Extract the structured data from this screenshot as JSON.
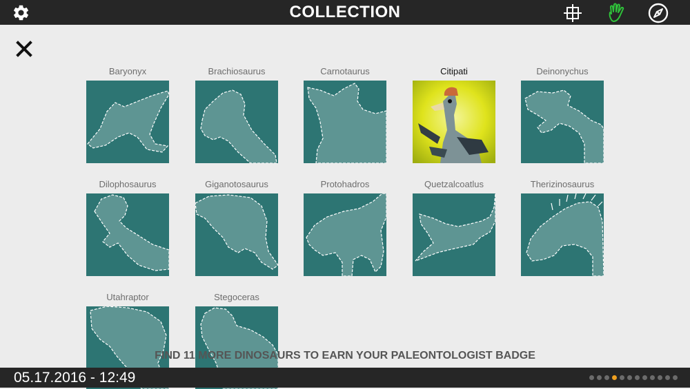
{
  "header": {
    "title": "COLLECTION",
    "settings_icon": "gear-icon",
    "scan_icon": "crosshair-frame-icon",
    "hand_icon": "hand-icon",
    "compass_icon": "compass-icon",
    "accent_color": "#2fc23a"
  },
  "close_icon": "close-icon",
  "tile_color": "#2d7573",
  "silhouette_color": "#5e9593",
  "collection": [
    {
      "name": "Baryonyx",
      "found": false
    },
    {
      "name": "Brachiosaurus",
      "found": false
    },
    {
      "name": "Carnotaurus",
      "found": false
    },
    {
      "name": "Citipati",
      "found": true
    },
    {
      "name": "Deinonychus",
      "found": false
    },
    {
      "name": "Dilophosaurus",
      "found": false
    },
    {
      "name": "Giganotosaurus",
      "found": false
    },
    {
      "name": "Protohadros",
      "found": false
    },
    {
      "name": "Quetzalcoatlus",
      "found": false
    },
    {
      "name": "Therizinosaurus",
      "found": false
    },
    {
      "name": "Utahraptor",
      "found": false
    },
    {
      "name": "Stegoceras",
      "found": false
    }
  ],
  "message": "FIND 11 MORE DINOSAURS TO EARN YOUR PALEONTOLOGIST BADGE",
  "footer": {
    "datetime": "05.17.2016 - 12:49",
    "page_count": 12,
    "current_page": 4
  }
}
